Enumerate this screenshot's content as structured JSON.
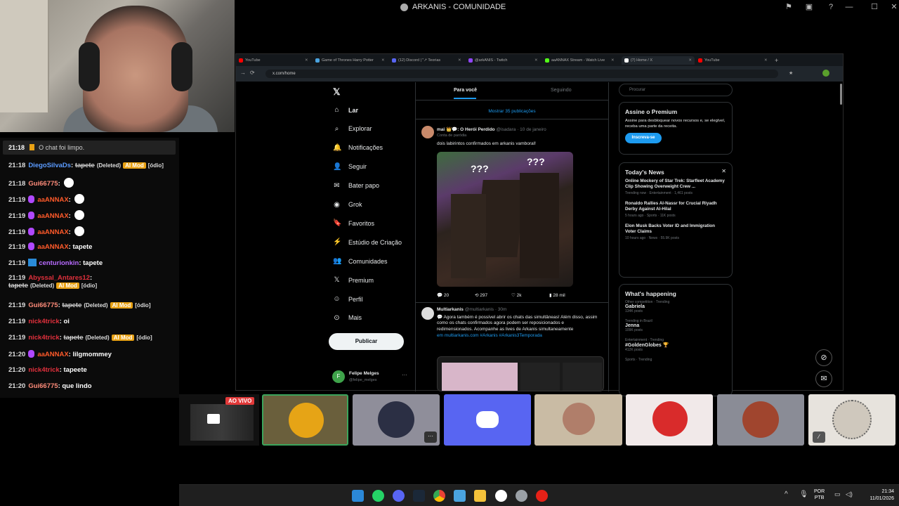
{
  "window": {
    "title": "ARKANIS - COMUNIDADE"
  },
  "chat": {
    "system": {
      "time": "21:18",
      "text": "O chat foi limpo."
    },
    "messages": [
      {
        "time": "21:18",
        "user": "DiegoSilvaDs",
        "color": "#5b9bff",
        "text": "tapete",
        "deleted": "(Deleted)",
        "mod": "AI Mod",
        "tag": "[ódio]"
      },
      {
        "time": "21:18",
        "user": "Gui66775",
        "color": "#ff8c7a",
        "text": ""
      },
      {
        "time": "21:19",
        "user": "aaANNAX",
        "color": "#ff5a2a",
        "text": ""
      },
      {
        "time": "21:19",
        "user": "aaANNAX",
        "color": "#ff5a2a",
        "text": ""
      },
      {
        "time": "21:19",
        "user": "aaANNAX",
        "color": "#ff5a2a",
        "text": ""
      },
      {
        "time": "21:19",
        "user": "aaANNAX",
        "color": "#ff5a2a",
        "text": "tapete"
      },
      {
        "time": "21:19",
        "user": "centurionkin",
        "color": "#b86bff",
        "text": "tapete"
      },
      {
        "time": "21:19",
        "user": "Abyssal_Antares12",
        "color": "#e0303c",
        "text": "tapete",
        "deleted": "(Deleted)",
        "mod": "AI Mod",
        "tag": "[ódio]"
      },
      {
        "time": "21:19",
        "user": "Gui66775",
        "color": "#ff8c7a",
        "text": "tapete",
        "deleted": "(Deleted)",
        "mod": "AI Mod",
        "tag": "[ódio]"
      },
      {
        "time": "21:19",
        "user": "nick4trick",
        "color": "#e0303c",
        "text": "oi"
      },
      {
        "time": "21:19",
        "user": "nick4trick",
        "color": "#e0303c",
        "text": "tapete",
        "deleted": "(Deleted)",
        "mod": "AI Mod",
        "tag": "[ódio]"
      },
      {
        "time": "21:20",
        "user": "aaANNAX",
        "color": "#ff5a2a",
        "text": "lilgmommey"
      },
      {
        "time": "21:20",
        "user": "nick4trick",
        "color": "#e0303c",
        "text": "tapeete"
      },
      {
        "time": "21:20",
        "user": "Gui66775",
        "color": "#ff8c7a",
        "text": "que lindo"
      }
    ]
  },
  "browser": {
    "tabs": [
      "YouTube",
      "Game of Thrones Harry Potter",
      "(12) Discord | \"↗ Teorias",
      "@arkANIS - Twitch",
      "aaANNAX Stream - Watch Live",
      "(7) Home / X",
      "YouTube"
    ],
    "url": "x.com/home",
    "new_tab": "+"
  },
  "x": {
    "nav": [
      "Lar",
      "Explorar",
      "Notificações",
      "Seguir",
      "Bater papo",
      "Grok",
      "Favoritos",
      "Estúdio de Criação",
      "Comunidades",
      "Premium",
      "Perfil",
      "Mais"
    ],
    "post_button": "Publicar",
    "profile": {
      "name": "Felipe Melges",
      "handle": "@felipe_melges"
    },
    "feed_tabs": [
      "Para você",
      "Seguindo"
    ],
    "show_more": "Mostrar 35 publicações",
    "post1": {
      "name": "mai 👑💬: O Herói Perdido",
      "handle": "@isadara · 10 de janeiro",
      "label": "Conta de paródia",
      "text": "dois labirintos confirmados em arkanis vamboral!",
      "qmarks": "???",
      "stats": [
        "20",
        "297",
        "2k",
        "28 mil"
      ]
    },
    "post2": {
      "name": "Multiarkanis",
      "handle": "@multiarkanis · 30m",
      "lines": [
        "💬 Agora também é possível abrir os chats das simultâneas! Além disso, assim",
        "como os chats confirmados agora podem ser reposicionados e",
        "redimensionados. Acompanhe as lives de Arkanis simultaneamente",
        "em multiarkanis.com #Arkanis #Arkanis3Temporada"
      ]
    },
    "search_placeholder": "Procurar",
    "premium": {
      "title": "Assine o Premium",
      "text": "Assine para desbloquear novos recursos e, se elegível, receba uma parte da receita.",
      "button": "Inscreva-se"
    },
    "news": {
      "title": "Today's News",
      "items": [
        {
          "headline": "Online Mockery of Star Trek: Starfleet Academy Clip Showing Overweight Crew ...",
          "meta": "Trending now · Entertainment · 1,461 posts"
        },
        {
          "headline": "Ronaldo Rallies Al-Nassr for Crucial Riyadh Derby Against Al-Hilal",
          "meta": "5 hours ago · Sports · 11K posts"
        },
        {
          "headline": "Elon Musk Backs Voter ID and Immigration Voter Claims",
          "meta": "10 hours ago · News · 55.9K posts"
        }
      ]
    },
    "happening": {
      "title": "What's happening",
      "items": [
        {
          "context": "Other competition · Trending",
          "name": "Gabriela",
          "count": "134K posts"
        },
        {
          "context": "Trending in Brazil",
          "name": "Jenna",
          "count": "109K posts"
        },
        {
          "context": "Entertainment · Trending",
          "name": "#GoldenGlobes 🏆",
          "count": "412K posts"
        },
        {
          "context": "Sports · Trending",
          "name": "",
          "count": ""
        }
      ]
    }
  },
  "stage": {
    "live_badge": "AO VIVO"
  },
  "taskbar": {
    "lang": "POR",
    "layout": "PTB",
    "time": "21:34",
    "date": "11/01/2026"
  }
}
